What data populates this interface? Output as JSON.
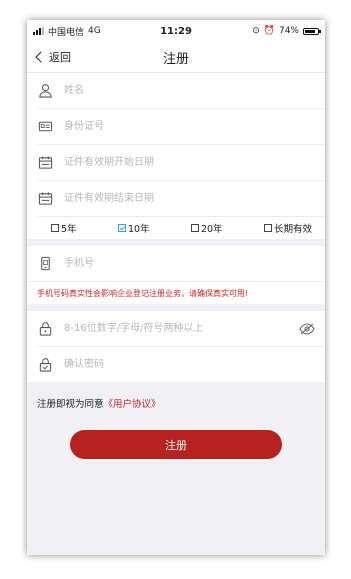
{
  "status_bar": {
    "carrier": "中国电信",
    "network": "4G",
    "time": "11:29",
    "battery": "74%",
    "battery_level": 0.74
  },
  "nav": {
    "back_label": "返回",
    "title": "注册"
  },
  "form": {
    "name_placeholder": "姓名",
    "id_placeholder": "身份证号",
    "start_date_placeholder": "证件有效期开始日期",
    "end_date_placeholder": "证件有效期结束日期",
    "validity_options": [
      {
        "label": "5年",
        "checked": false
      },
      {
        "label": "10年",
        "checked": true
      },
      {
        "label": "20年",
        "checked": false
      },
      {
        "label": "长期有效",
        "checked": false
      }
    ],
    "phone_placeholder": "手机号",
    "phone_warning": "手机号码真实性会影响企业登记注册业务，请确保真实可用!",
    "password_placeholder": "8-16位数字/字母/符号两种以上",
    "confirm_placeholder": "确认密码"
  },
  "agreement": {
    "prefix": "注册即视为同意",
    "link": "《用户协议》"
  },
  "submit_label": "注册",
  "colors": {
    "accent": "#b5221f",
    "warning": "#d0262a",
    "checkbox": "#3a9fe0"
  }
}
